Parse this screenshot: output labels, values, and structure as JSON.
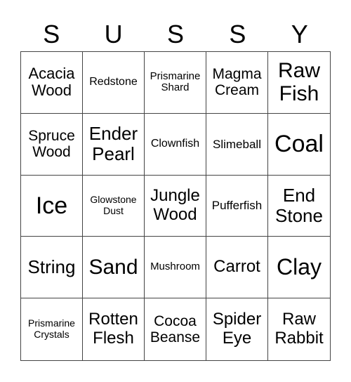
{
  "header": {
    "letters": [
      "S",
      "U",
      "S",
      "S",
      "Y"
    ]
  },
  "board": {
    "cells": [
      "Acacia Wood",
      "Redstone",
      "Prismarine Shard",
      "Magma Cream",
      "Raw Fish",
      "Spruce Wood",
      "Ender Pearl",
      "Clownfish",
      "Slimeball",
      "Coal",
      "Ice",
      "Glowstone Dust",
      "Jungle Wood",
      "Pufferfish",
      "End Stone",
      "String",
      "Sand",
      "Mushroom",
      "Carrot",
      "Clay",
      "Prismarine Crystals",
      "Rotten Flesh",
      "Cocoa Beanse",
      "Spider Eye",
      "Raw Rabbit"
    ]
  }
}
